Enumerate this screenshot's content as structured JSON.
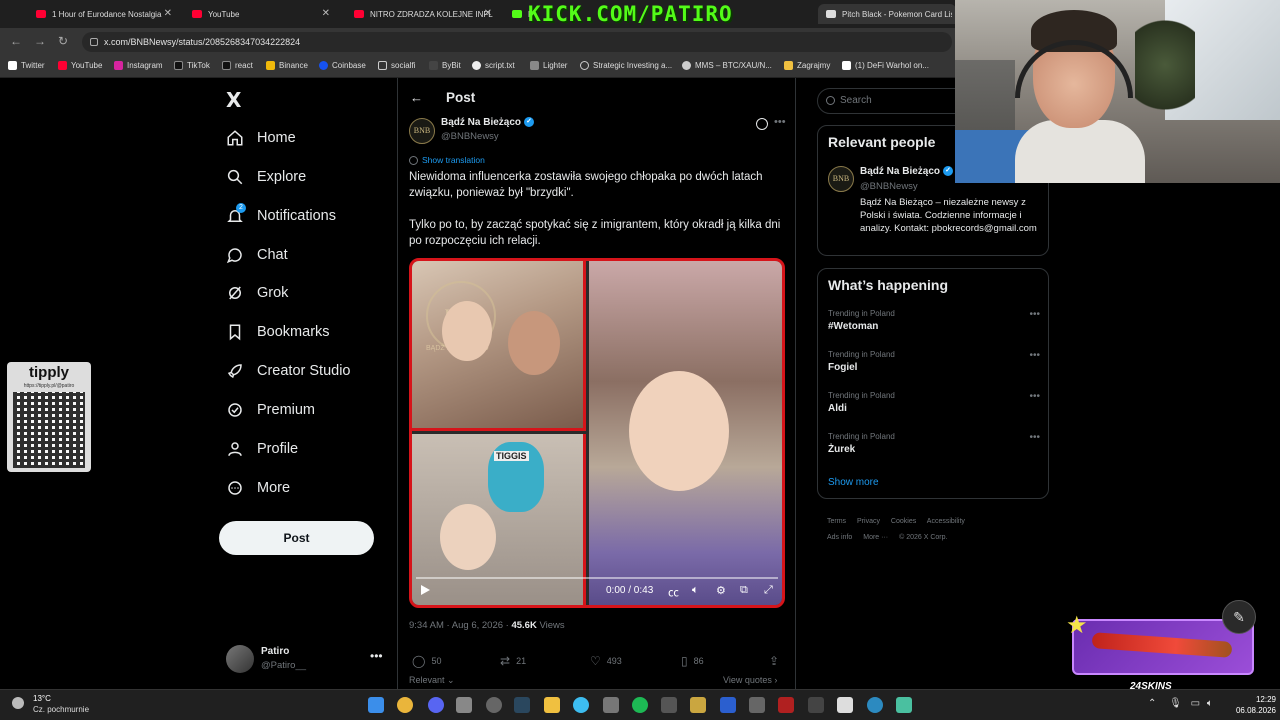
{
  "browser": {
    "tabs": [
      {
        "title": "1 Hour of Eurodance Nostalgia",
        "color": "#ff0033"
      },
      {
        "title": "YouTube",
        "color": "#ff0033"
      },
      {
        "title": "NITRO ZDRADZA KOLEJNE INFL",
        "color": "#ff0033"
      },
      {
        "title": "P",
        "color": "#53fc18"
      },
      {
        "title": "Pitch Black - Pokemon Card List",
        "color": "#dddddd"
      }
    ],
    "overlay_text": "KICK.COM/PATIRO",
    "url": "x.com/BNBNewsy/status/2085268347034222824",
    "bookmarks": [
      "Twitter",
      "YouTube",
      "Instagram",
      "TikTok",
      "react",
      "Binance",
      "Coinbase",
      "socialfi",
      "ByBit",
      "script.txt",
      "Lighter",
      "Strategic Investing a...",
      "MMS – BTC/XAU/N...",
      "Zagrajmy",
      "(1) DeFi Warhol on..."
    ]
  },
  "nav": {
    "logo": "X",
    "items": [
      "Home",
      "Explore",
      "Notifications",
      "Chat",
      "Grok",
      "Bookmarks",
      "Creator Studio",
      "Premium",
      "Profile",
      "More"
    ],
    "notifications_badge": "2",
    "post_button": "Post",
    "account": {
      "name": "Patiro",
      "handle": "@Patiro__",
      "more": "•••"
    }
  },
  "tipply": {
    "title": "tipply",
    "url": "https://tipply.pl/@patiro"
  },
  "post": {
    "header_title": "Post",
    "back": "←",
    "author_name": "Bądź Na Bieżąco",
    "author_handle": "@BNBNewsy",
    "avatar_text": "BNB",
    "show_translation": "Show translation",
    "text_p1": "Niewidoma influencerka zostawiła swojego chłopaka po dwóch latach związku, ponieważ był \"brzydki\".",
    "text_p2": "Tylko po to, by zacząć spotykać się z imigrantem, który okradł ją kilka dni po rozpoczęciu ich relacji.",
    "video": {
      "time": "0:00 / 0:43",
      "watermark": "BNB",
      "watermark_text": "BĄDŹ NA BIEŻĄCO",
      "cap_text": "TIGGIS",
      "progress": 0
    },
    "time": "9:34 AM · Aug 6, 2026 · ",
    "views_count": "45.6K",
    "views_label": " Views",
    "replies": "50",
    "reposts": "21",
    "likes": "493",
    "bookmarks": "86",
    "relevant": "Relevant ⌄",
    "view_quotes": "View quotes ›"
  },
  "search": {
    "placeholder": "Search"
  },
  "relevant_people": {
    "title": "Relevant people",
    "name": "Bądź Na Bieżąco",
    "handle": "@BNBNewsy",
    "bio": "Bądź Na Bieżąco – niezależne newsy z Polski i świata. Codzienne informacje i analizy. Kontakt: pbokrecords@gmail.com"
  },
  "happening": {
    "title": "What’s happening",
    "trends": [
      {
        "label": "Trending in Poland",
        "name": "#Wetoman"
      },
      {
        "label": "Trending in Poland",
        "name": "Fogiel"
      },
      {
        "label": "Trending in Poland",
        "name": "Aldi"
      },
      {
        "label": "Trending in Poland",
        "name": "Żurek"
      }
    ],
    "show_more": "Show more"
  },
  "footer": {
    "links1": [
      "Terms",
      "Privacy",
      "Cookies",
      "Accessibility"
    ],
    "links2": [
      "Ads info",
      "More ···",
      "© 2026 X Corp."
    ]
  },
  "skins": {
    "brand": "24SKINS"
  },
  "taskbar": {
    "temp": "13°C",
    "weather": "Cz. pochmurnie",
    "time": "12:29",
    "date": "06.08.2026"
  }
}
